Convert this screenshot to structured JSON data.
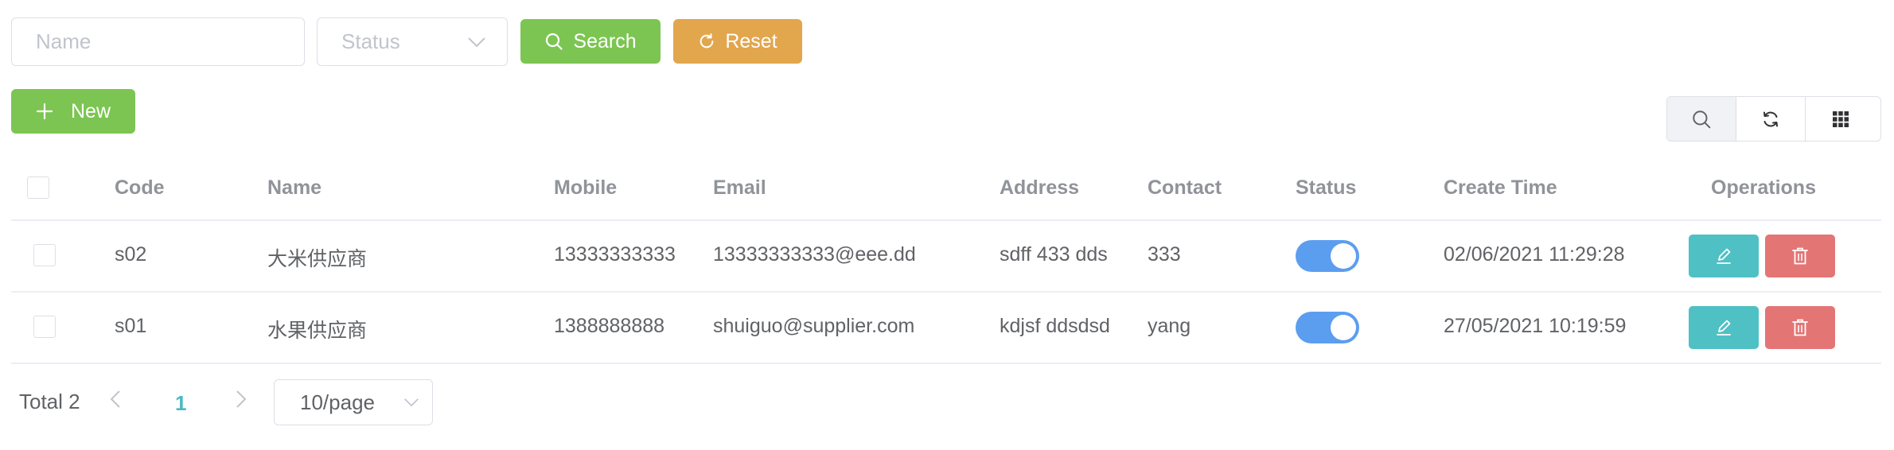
{
  "search": {
    "name_placeholder": "Name",
    "status_placeholder": "Status",
    "search_label": "Search",
    "reset_label": "Reset"
  },
  "actions": {
    "new_label": "New"
  },
  "table": {
    "headers": {
      "code": "Code",
      "name": "Name",
      "mobile": "Mobile",
      "email": "Email",
      "address": "Address",
      "contact": "Contact",
      "status": "Status",
      "create_time": "Create Time",
      "operations": "Operations"
    },
    "rows": [
      {
        "code": "s02",
        "name": "大米供应商",
        "mobile": "13333333333",
        "email": "13333333333@eee.dd",
        "address": "sdff 433 dds",
        "contact": "333",
        "status": true,
        "create_time": "02/06/2021 11:29:28"
      },
      {
        "code": "s01",
        "name": "水果供应商",
        "mobile": "1388888888",
        "email": "shuiguo@supplier.com",
        "address": "kdjsf ddsdsd",
        "contact": "yang",
        "status": true,
        "create_time": "27/05/2021 10:19:59"
      }
    ]
  },
  "pagination": {
    "total_label": "Total 2",
    "current_page": "1",
    "page_size": "10/page"
  },
  "colors": {
    "primary_green": "#7cc552",
    "warning_orange": "#e2a64d",
    "edit_teal": "#4fc0c4",
    "delete_red": "#e47575",
    "switch_on": "#5b9ef0"
  },
  "icons": {
    "search_button": "search-icon",
    "reset_button": "refresh-icon",
    "new_button": "plus-icon",
    "toolbar": [
      "search-icon",
      "refresh-icon",
      "grid-icon"
    ],
    "row_ops": [
      "edit-icon",
      "delete-icon"
    ],
    "pagination": [
      "chevron-left-icon",
      "chevron-right-icon",
      "chevron-down-icon"
    ]
  }
}
